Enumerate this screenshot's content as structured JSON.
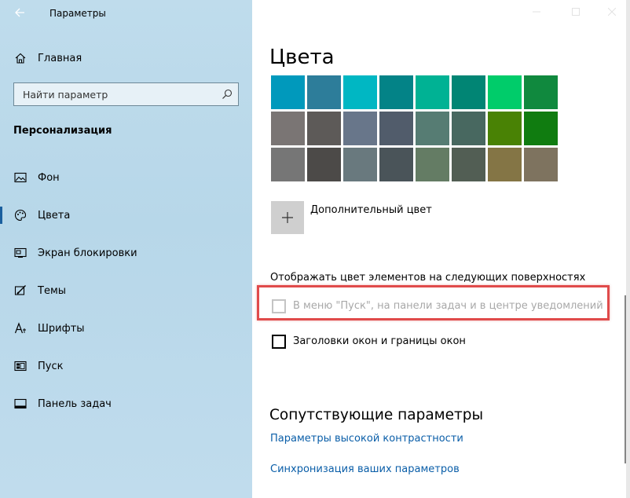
{
  "window": {
    "title": "Параметры"
  },
  "sidebar": {
    "home_label": "Главная",
    "search_placeholder": "Найти параметр",
    "section_title": "Персонализация",
    "items": [
      {
        "label": "Фон",
        "icon": "picture-icon"
      },
      {
        "label": "Цвета",
        "icon": "palette-icon",
        "active": true
      },
      {
        "label": "Экран блокировки",
        "icon": "lock-screen-icon"
      },
      {
        "label": "Темы",
        "icon": "brush-icon"
      },
      {
        "label": "Шрифты",
        "icon": "font-icon"
      },
      {
        "label": "Пуск",
        "icon": "start-icon"
      },
      {
        "label": "Панель задач",
        "icon": "taskbar-icon"
      }
    ]
  },
  "main": {
    "page_title": "Цвета",
    "swatches": [
      [
        "#0099bc",
        "#2d7d9a",
        "#00b7c3",
        "#038387",
        "#00b294",
        "#018574",
        "#00cc6a",
        "#10893e"
      ],
      [
        "#7a7574",
        "#5d5a58",
        "#68768a",
        "#515c6b",
        "#567c73",
        "#486860",
        "#498205",
        "#107c10"
      ],
      [
        "#767676",
        "#4c4a48",
        "#69797e",
        "#4a5459",
        "#647c64",
        "#525e54",
        "#847545",
        "#7e735f"
      ]
    ],
    "add_color_label": "Дополнительный цвет",
    "surfaces_label": "Отображать цвет элементов на следующих поверхностях",
    "checkbox_start": {
      "label": "В меню \"Пуск\", на панели задач и в центре уведомлений",
      "checked": false,
      "disabled": true
    },
    "checkbox_titlebars": {
      "label": "Заголовки окон и границы окон",
      "checked": false
    },
    "related_title": "Сопутствующие параметры",
    "links": [
      "Параметры высокой контрастности",
      "Синхронизация ваших параметров"
    ]
  },
  "colors": {
    "accent_link": "#0a5ea8",
    "highlight": "#e04b4b",
    "sidebar_bg": "#bbd9eb"
  }
}
